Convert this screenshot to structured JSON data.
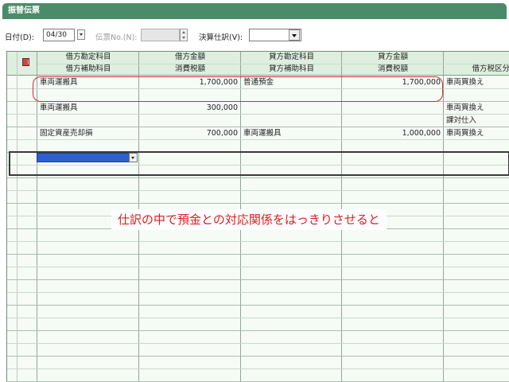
{
  "window": {
    "title": "振替伝票"
  },
  "toolbar": {
    "date_label": "日付(D):",
    "date_value": "04/30",
    "slip_no_label": "伝票No.(N):",
    "slip_no_value": "",
    "closing_label": "決算仕訳(V):",
    "closing_value": ""
  },
  "table": {
    "headers": {
      "debit_account": "借方勘定科目",
      "debit_sub_account": "借方補助科目",
      "debit_amount": "借方金額",
      "debit_tax_amount": "消費税額",
      "credit_account": "貸方勘定科目",
      "credit_sub_account": "貸方補助科目",
      "credit_amount": "貸方金額",
      "credit_tax_amount": "消費税額",
      "debit_tax_class": "借方税区分"
    },
    "rows": [
      {
        "debit_account": "車両運搬具",
        "debit_amount": "1,700,000",
        "credit_account": "普通預金",
        "credit_amount": "1,700,000",
        "tax_class": "車両買換え",
        "tax_class_2": ""
      },
      {
        "debit_account": "車両運搬具",
        "debit_amount": "300,000",
        "credit_account": "",
        "credit_amount": "",
        "tax_class": "車両買換え",
        "tax_class_2": "課対仕入"
      },
      {
        "debit_account": "固定資産売却損",
        "debit_amount": "700,000",
        "credit_account": "車両運搬具",
        "credit_amount": "1,000,000",
        "tax_class": "車両買換え",
        "tax_class_2": ""
      }
    ]
  },
  "annotation": {
    "text": "仕訳の中で預金との対応関係をはっきりさせると"
  },
  "colors": {
    "title_bar": "#4a8c6a",
    "header_bg": "#dfefdf",
    "highlight": "#d82828",
    "annotation_text": "#d82020",
    "selection": "#2f5fcf"
  }
}
